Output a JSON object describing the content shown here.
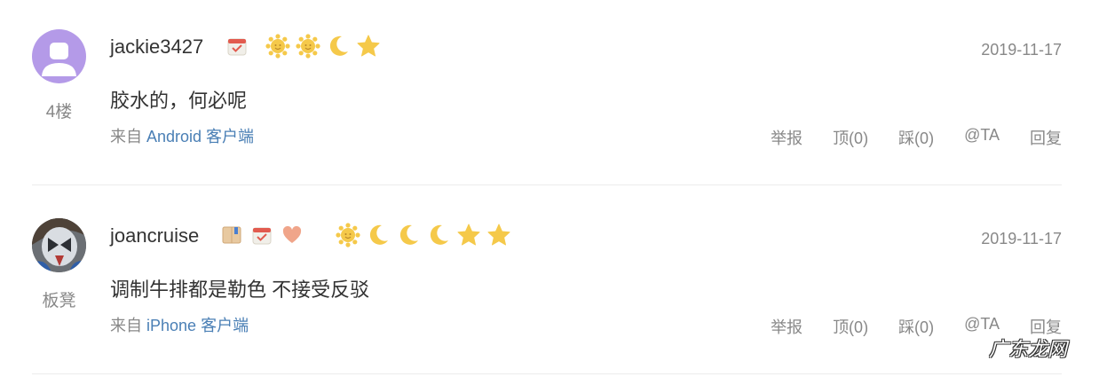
{
  "comments": [
    {
      "username": "jackie3427",
      "floor": "4楼",
      "date": "2019-11-17",
      "content": "胶水的，何必呢",
      "source_prefix": "来自",
      "source_device": "Android 客户端",
      "avatar_color": "#b49ae8",
      "badges": [
        "calendar-badge-icon"
      ],
      "levels": [
        "sun-icon",
        "sun-icon",
        "moon-icon",
        "star-icon"
      ],
      "actions": [
        "举报",
        "顶(0)",
        "踩(0)",
        "@TA",
        "回复"
      ]
    },
    {
      "username": "joancruise",
      "floor": "板凳",
      "date": "2019-11-17",
      "content": "调制牛排都是勒色 不接受反驳",
      "source_prefix": "来自",
      "source_device": "iPhone 客户端",
      "badges": [
        "book-badge-icon",
        "calendar-badge-icon",
        "heart-badge-icon"
      ],
      "levels": [
        "sun-icon",
        "moon-icon",
        "moon-icon",
        "moon-icon",
        "star-icon",
        "star-icon"
      ],
      "actions": [
        "举报",
        "顶(0)",
        "踩(0)",
        "@TA",
        "回复"
      ]
    }
  ],
  "watermark": "广东龙网",
  "colors": {
    "level_icon": "#f5c94a",
    "link": "#4a7fb5",
    "muted": "#888888",
    "divider": "#ececec"
  }
}
